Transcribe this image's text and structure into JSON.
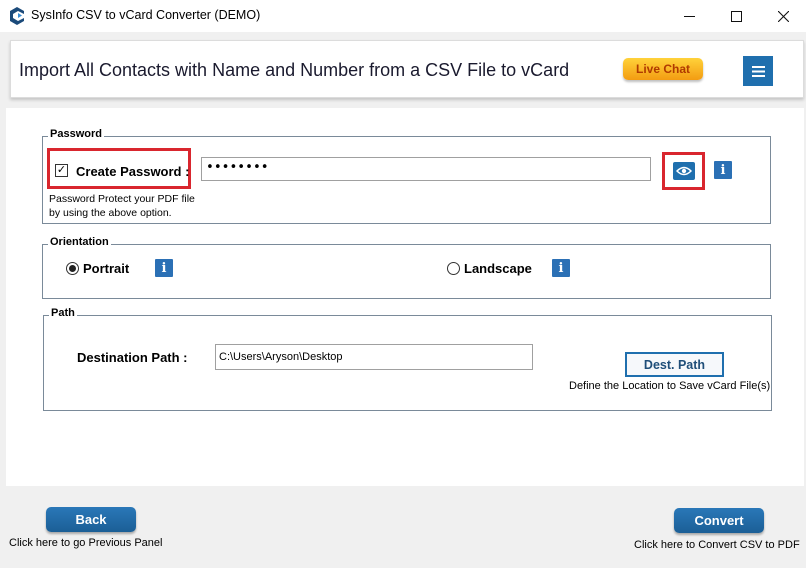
{
  "window": {
    "title": "SysInfo CSV to vCard Converter (DEMO)",
    "minimize_glyph": "—",
    "maximize_glyph": "☐",
    "close_glyph": "✕"
  },
  "header": {
    "title": "Import All Contacts with Name and Number from a CSV File to vCard",
    "live_chat_label": "Live Chat",
    "menu_icon": "hamburger-menu-icon"
  },
  "password": {
    "legend": "Password",
    "create_password_label": "Create Password :",
    "create_password_checked": true,
    "checkbox_glyph": "✓",
    "value": "••••••••",
    "note_line1": "Password Protect your PDF file",
    "note_line2": "by using the above option.",
    "show_password_icon": "eye-icon",
    "info_icon": "info-icon"
  },
  "orientation": {
    "legend": "Orientation",
    "options": [
      {
        "label": "Portrait",
        "selected": true
      },
      {
        "label": "Landscape",
        "selected": false
      }
    ],
    "info_glyph": "i"
  },
  "path": {
    "legend": "Path",
    "destination_label": "Destination Path :",
    "destination_value": "C:\\Users\\Aryson\\Desktop",
    "dest_button_label": "Dest. Path",
    "dest_hint": "Define the Location to Save vCard File(s)"
  },
  "footer": {
    "back_label": "Back",
    "back_hint": "Click here to go Previous Panel",
    "convert_label": "Convert",
    "convert_hint": "Click here to Convert CSV to PDF"
  },
  "colors": {
    "accent_blue": "#1f6fae",
    "highlight_red": "#d9262e",
    "live_chat_orange": "#f39c12"
  }
}
